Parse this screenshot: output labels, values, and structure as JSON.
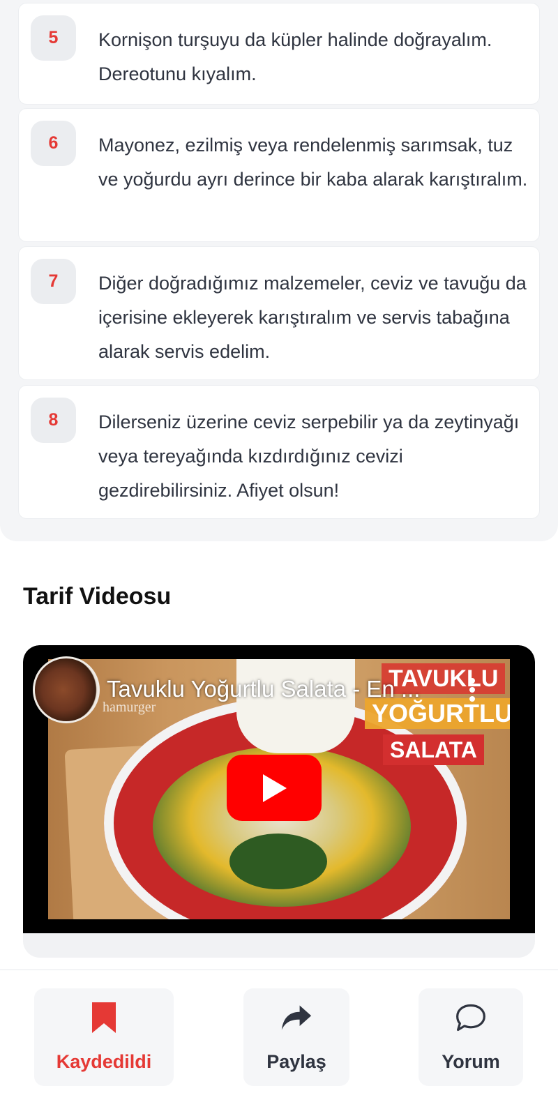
{
  "steps": [
    {
      "number": "5",
      "text": "Kornişon turşuyu da küpler halinde doğrayalım. Dereotunu kıyalım."
    },
    {
      "number": "6",
      "text": "Mayonez, ezilmiş veya rendelenmiş sarımsak, tuz ve yoğurdu ayrı derince bir kaba alarak karıştıralım."
    },
    {
      "number": "7",
      "text": "Diğer doğradığımız malzemeler, ceviz ve tavuğu da içerisine ekleyerek karıştıralım ve servis tabağına alarak servis edelim."
    },
    {
      "number": "8",
      "text": "Dilerseniz üzerine ceviz serpebilir ya da zeytinyağı veya tereyağında kızdırdığınız cevizi gezdirebilirsiniz. Afiyet olsun!"
    }
  ],
  "video_section": {
    "title": "Tarif Videosu",
    "video_title": "Tavuklu Yoğurtlu Salata - En ...",
    "channel": "hamurger",
    "thumbnail_overlay": [
      "TAVUKLU",
      "YOĞURTLU",
      "SALATA"
    ],
    "play_icon": "play-icon",
    "menu_icon": "more-vertical-icon"
  },
  "actions": {
    "save": {
      "label": "Kaydedildi",
      "icon": "bookmark-icon",
      "color": "#e53935"
    },
    "share": {
      "label": "Paylaş",
      "icon": "share-icon",
      "color": "#2f3440"
    },
    "comment": {
      "label": "Yorum",
      "icon": "comment-icon",
      "color": "#2f3440"
    }
  },
  "colors": {
    "accent": "#e53935",
    "text": "#2f3440",
    "badge_bg": "#ebedf0",
    "youtube_red": "#ff0000"
  }
}
